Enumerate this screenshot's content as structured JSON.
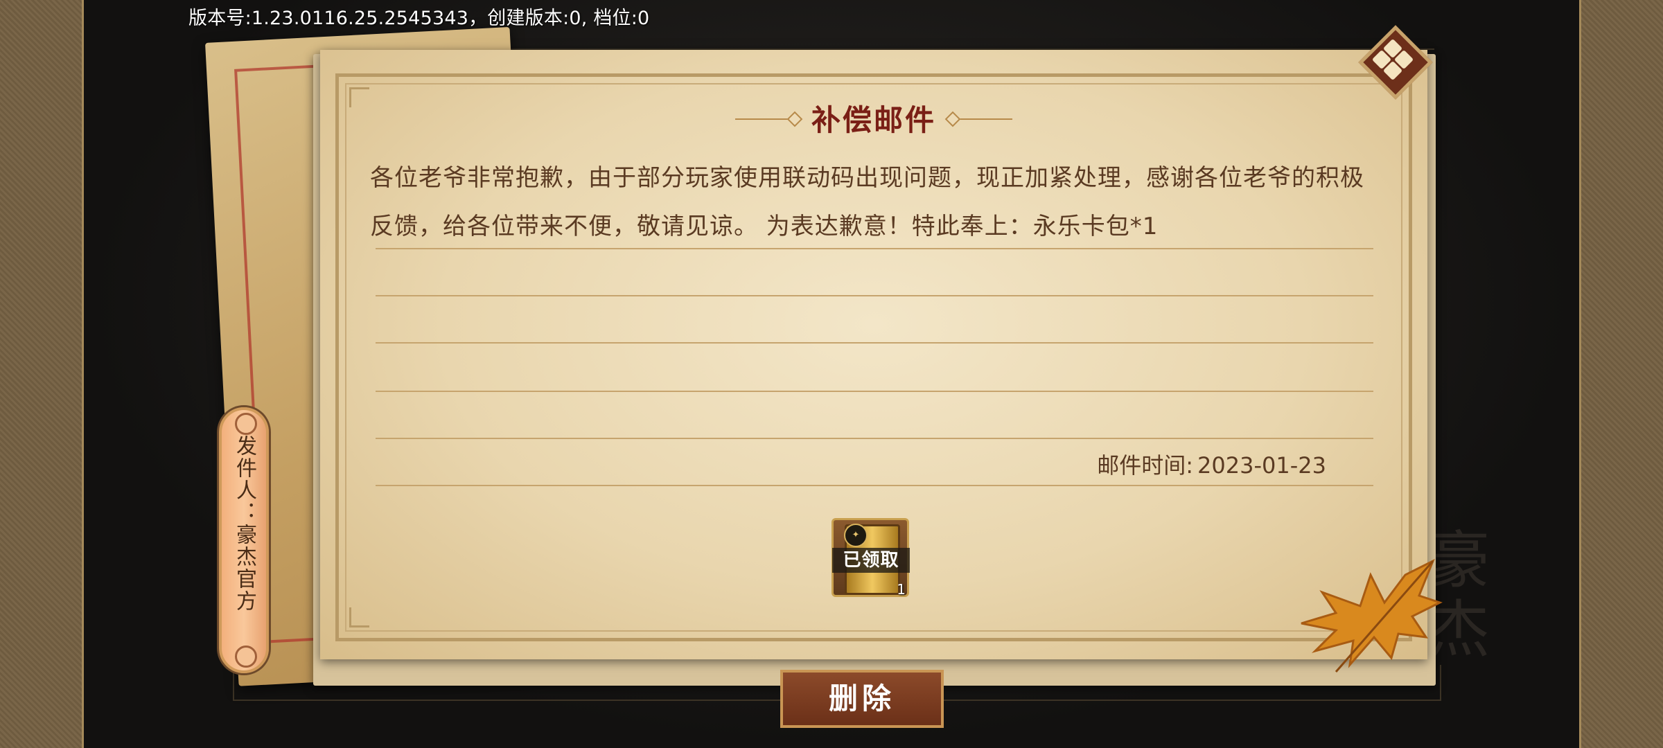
{
  "version_info": "版本号:1.23.0116.25.2545343，创建版本:0, 档位:0",
  "mail": {
    "title": "补偿邮件",
    "body": "各位老爷非常抱歉，由于部分玩家使用联动码出现问题，现正加紧处理，感谢各位老爷的积极反馈，给各位带来不便，敬请见谅。 为表达歉意！特此奉上：永乐卡包*1",
    "time_label": "邮件时间:",
    "time_value": "2023-01-23"
  },
  "attachment": {
    "status": "已领取",
    "quantity": "1",
    "icon": "card-pack-icon"
  },
  "sender": {
    "label": "发件人：豪杰官方"
  },
  "buttons": {
    "delete": "删除",
    "close_icon": "close-icon"
  },
  "colors": {
    "title": "#7a1f16",
    "body_text": "#5a3a22",
    "delete_bg": "#8c4a2a",
    "sender_tag": "#f9c89b"
  }
}
